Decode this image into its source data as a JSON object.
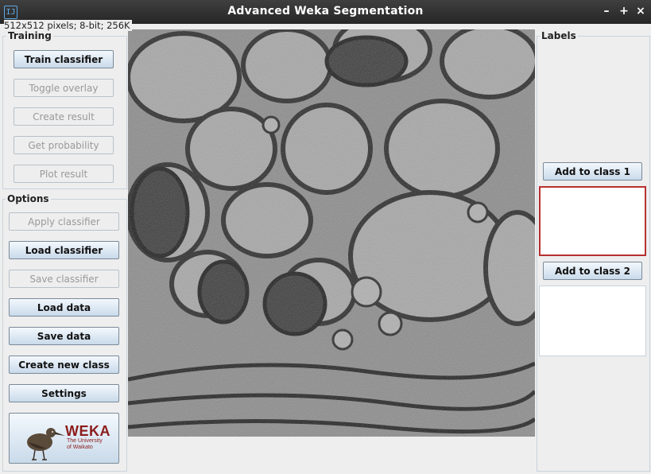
{
  "window": {
    "title": "Advanced Weka Segmentation",
    "controls": {
      "minimize": "–",
      "maximize": "+",
      "close": "×"
    }
  },
  "image_info": "512x512 pixels; 8-bit; 256K",
  "training": {
    "title": "Training",
    "buttons": [
      {
        "label": "Train classifier",
        "enabled": true
      },
      {
        "label": "Toggle overlay",
        "enabled": false
      },
      {
        "label": "Create result",
        "enabled": false
      },
      {
        "label": "Get probability",
        "enabled": false
      },
      {
        "label": "Plot result",
        "enabled": false
      }
    ]
  },
  "options": {
    "title": "Options",
    "buttons": [
      {
        "label": "Apply classifier",
        "enabled": false
      },
      {
        "label": "Load classifier",
        "enabled": true
      },
      {
        "label": "Save classifier",
        "enabled": false
      },
      {
        "label": "Load data",
        "enabled": true
      },
      {
        "label": "Save data",
        "enabled": true
      },
      {
        "label": "Create new class",
        "enabled": true
      },
      {
        "label": "Settings",
        "enabled": true
      }
    ],
    "logo": {
      "text": "WEKA",
      "subtitle": "The University of Waikato"
    }
  },
  "labels": {
    "title": "Labels",
    "classes": [
      {
        "button": "Add to class 1",
        "color": "#cc3333"
      },
      {
        "button": "Add to class 2",
        "color": "#c8d2dc"
      }
    ]
  },
  "colors": {
    "titlebar": "#2f2f2f",
    "accent_blue": "#5fa8e8",
    "weka_red": "#8b1c1c"
  }
}
